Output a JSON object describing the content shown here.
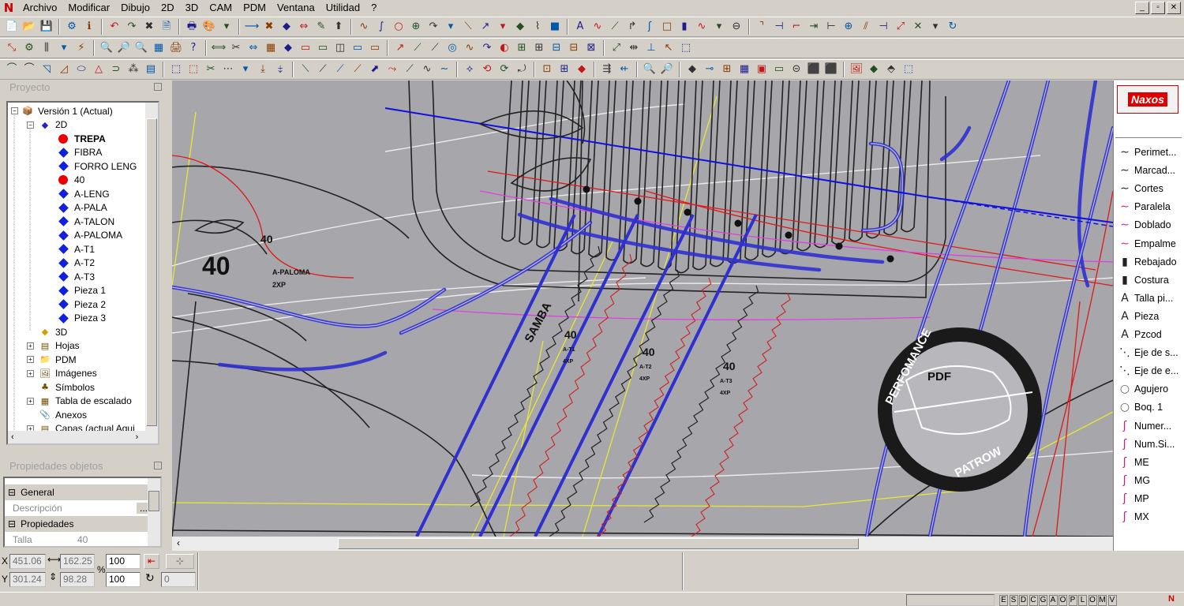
{
  "menu": [
    "Archivo",
    "Modificar",
    "Dibujo",
    "2D",
    "3D",
    "CAM",
    "PDM",
    "Ventana",
    "Utilidad",
    "?"
  ],
  "window_controls": [
    "_",
    "▫",
    "✕"
  ],
  "toolbar_rows": [
    {
      "icons": [
        "📄",
        "📂",
        "💾",
        "|",
        "⚙",
        "ℹ",
        "|",
        "↶",
        "↷",
        "✖",
        "🗎",
        "|",
        "🖶",
        "🎨",
        "▾",
        "|",
        "⟶",
        "✖",
        "◆",
        "⇔",
        "✎",
        "⬆",
        "|",
        "∿",
        "∫",
        "○",
        "⊕",
        "↷",
        "▾",
        "⟍",
        "↗",
        "▾",
        "◆",
        "⌇",
        "■",
        "|",
        "A",
        "∿",
        "⟋",
        "↱",
        "ʃ",
        "□",
        "▮",
        "∿",
        "▾",
        "⊖",
        "|",
        "⌝",
        "⊣",
        "⌐",
        "⇥",
        "⊢",
        "⊕",
        "⫽",
        "⊣",
        "⤢",
        "✕",
        "▾",
        "↻"
      ]
    },
    {
      "icons": [
        "⤡",
        "⚙",
        "⫼",
        "▾",
        "⚡",
        "|",
        "🔍",
        "🔎",
        "🔍",
        "▦",
        "🖨",
        "?",
        "|",
        "⟺",
        "✂",
        "⇔",
        "▦",
        "◆",
        "▭",
        "▭",
        "◫",
        "▭",
        "▭",
        "|",
        "↗",
        "⟋",
        "⟋",
        "◎",
        "∿",
        "↷",
        "◐",
        "⊞",
        "⊞",
        "⊟",
        "⊟",
        "⊠",
        "|",
        "⤢",
        "⇹",
        "⊥",
        "↖",
        "⬚"
      ]
    },
    {
      "icons": [
        "⌒",
        "⌒",
        "◹",
        "◿",
        "⬭",
        "△",
        "⊃",
        "⁂",
        "▤",
        "|",
        "⬚",
        "⬚",
        "✂",
        "⋯",
        "▾",
        "⤓",
        "⤈",
        "|",
        "⟍",
        "⟋",
        "⟋",
        "⟋",
        "⬈",
        "⤳",
        "⟋",
        "∿",
        "∼",
        "|",
        "⟡",
        "⟲",
        "⟳",
        "⤾",
        "|",
        "⊡",
        "⊞",
        "◆",
        "|",
        "⇶",
        "⇷",
        "|",
        "🔍",
        "🔎",
        "|",
        "◆",
        "⊸",
        "⊞",
        "▦",
        "▣",
        "▭",
        "⊝",
        "⬛",
        "⬛",
        "|",
        "🖼",
        "◆",
        "⬘",
        "⬚"
      ]
    }
  ],
  "project_panel": {
    "title": "Proyecto",
    "tree": [
      {
        "label": "Versión 1 (Actual)",
        "icon": "version-icon",
        "indent": 0,
        "expander": "−"
      },
      {
        "label": "2D",
        "icon": "2d-icon",
        "indent": 1,
        "expander": "−"
      },
      {
        "label": "TREPA",
        "icon": "red-dot",
        "indent": 2,
        "bold": true
      },
      {
        "label": "FIBRA",
        "icon": "blue-diamond",
        "indent": 2
      },
      {
        "label": "FORRO LENG",
        "icon": "blue-diamond",
        "indent": 2
      },
      {
        "label": "40",
        "icon": "red-dot",
        "indent": 2
      },
      {
        "label": "A-LENG",
        "icon": "blue-diamond",
        "indent": 2
      },
      {
        "label": "A-PALA",
        "icon": "blue-diamond",
        "indent": 2
      },
      {
        "label": "A-TALON",
        "icon": "blue-diamond",
        "indent": 2
      },
      {
        "label": "A-PALOMA",
        "icon": "blue-diamond",
        "indent": 2
      },
      {
        "label": "A-T1",
        "icon": "blue-diamond",
        "indent": 2
      },
      {
        "label": "A-T2",
        "icon": "blue-diamond",
        "indent": 2
      },
      {
        "label": "A-T3",
        "icon": "blue-diamond",
        "indent": 2
      },
      {
        "label": "Pieza 1",
        "icon": "blue-diamond",
        "indent": 2
      },
      {
        "label": "Pieza 2",
        "icon": "blue-diamond",
        "indent": 2
      },
      {
        "label": "Pieza 3",
        "icon": "blue-diamond",
        "indent": 2
      },
      {
        "label": "3D",
        "icon": "3d-icon",
        "indent": 1
      },
      {
        "label": "Hojas",
        "icon": "sheets-icon",
        "indent": 1,
        "expander": "+"
      },
      {
        "label": "PDM",
        "icon": "folder-icon",
        "indent": 1,
        "expander": "+"
      },
      {
        "label": "Imágenes",
        "icon": "image-icon",
        "indent": 1,
        "expander": "+"
      },
      {
        "label": "Símbolos",
        "icon": "symbol-icon",
        "indent": 1
      },
      {
        "label": "Tabla de escalado",
        "icon": "table-icon",
        "indent": 1,
        "expander": "+"
      },
      {
        "label": "Anexos",
        "icon": "paperclip-icon",
        "indent": 1
      },
      {
        "label": "Capas (actual Aguj",
        "icon": "layers-icon",
        "indent": 1,
        "expander": "+"
      }
    ]
  },
  "properties_panel": {
    "title": "Propiedades objetos",
    "rows": [
      {
        "type": "header",
        "label": "General"
      },
      {
        "type": "field",
        "key": "Descripción",
        "value": "",
        "has_button": true
      },
      {
        "type": "header",
        "label": "Propiedades"
      },
      {
        "type": "field",
        "key": "Talla",
        "value": "40"
      }
    ]
  },
  "canvas": {
    "labels": [
      "40",
      "A-PALOMA",
      "2XP",
      "40",
      "SAMBA",
      "40",
      "A-T1",
      "4XP",
      "40",
      "A-T2",
      "4XP",
      "40",
      "A-T3",
      "4XP"
    ],
    "stamp": {
      "top": "PERFOMANCE",
      "center": "PDF",
      "bottom": "PATROW"
    }
  },
  "right_panel": {
    "brand": "Naxos",
    "items": [
      {
        "label": "Perimet...",
        "icon": "∼"
      },
      {
        "label": "Marcad...",
        "icon": "∼"
      },
      {
        "label": "Cortes",
        "icon": "∼"
      },
      {
        "label": "Paralela",
        "icon": "∼"
      },
      {
        "label": "Doblado",
        "icon": "∼"
      },
      {
        "label": "Empalme",
        "icon": "∼"
      },
      {
        "label": "Rebajado",
        "icon": "▮"
      },
      {
        "label": "Costura",
        "icon": "▮"
      },
      {
        "label": "Talla pi...",
        "icon": "A"
      },
      {
        "label": "Pieza",
        "icon": "A"
      },
      {
        "label": "Pzcod",
        "icon": "A"
      },
      {
        "label": "Eje de s...",
        "icon": "⋱"
      },
      {
        "label": "Eje de e...",
        "icon": "⋱"
      },
      {
        "label": "Agujero",
        "icon": "○"
      },
      {
        "label": "Boq. 1",
        "icon": "○"
      },
      {
        "label": "Numer...",
        "icon": "ʃ"
      },
      {
        "label": "Num.Si...",
        "icon": "ʃ"
      },
      {
        "label": "ME",
        "icon": "ʃ"
      },
      {
        "label": "MG",
        "icon": "ʃ"
      },
      {
        "label": "MP",
        "icon": "ʃ"
      },
      {
        "label": "MX",
        "icon": "ʃ"
      }
    ]
  },
  "coords": {
    "x_label": "X",
    "x": "451.06",
    "dx": "162.25",
    "y_label": "Y",
    "y": "301.24",
    "dy": "98.28",
    "pct_label": "%",
    "zoom1": "100",
    "zoom2": "100",
    "angle": "0"
  },
  "status_letters": [
    "E",
    "S",
    "D",
    "C",
    "G",
    "A",
    "O",
    "P",
    "L",
    "O",
    "M",
    "V"
  ]
}
